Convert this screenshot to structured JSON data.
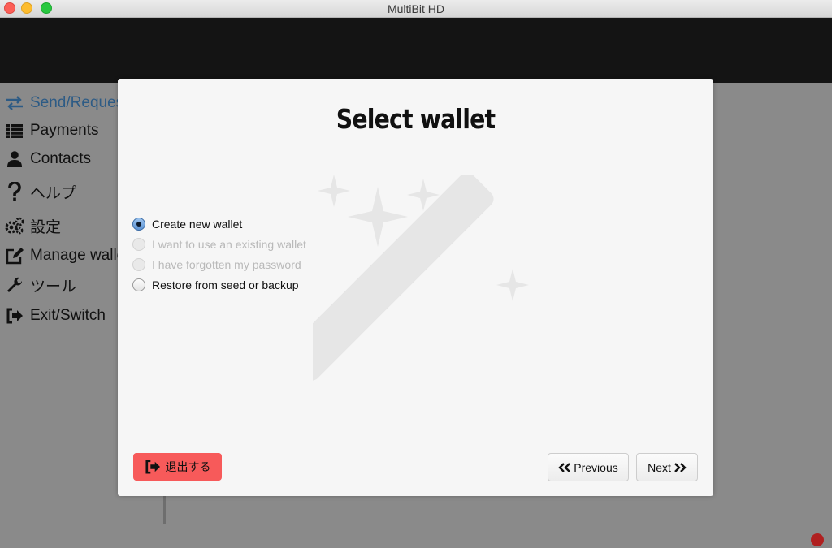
{
  "window": {
    "title": "MultiBit HD"
  },
  "sidebar": {
    "items": [
      {
        "label": "Send/Request",
        "icon": "exchange-icon",
        "active": true
      },
      {
        "label": "Payments",
        "icon": "list-icon"
      },
      {
        "label": "Contacts",
        "icon": "user-icon"
      },
      {
        "label": "ヘルプ",
        "icon": "question-icon"
      },
      {
        "label": "設定",
        "icon": "gears-icon"
      },
      {
        "label": "Manage wallet",
        "icon": "edit-icon"
      },
      {
        "label": "ツール",
        "icon": "wrench-icon"
      },
      {
        "label": "Exit/Switch",
        "icon": "sign-out-icon"
      }
    ]
  },
  "dialog": {
    "title": "Select wallet",
    "options": [
      {
        "label": "Create new wallet",
        "checked": true,
        "enabled": true
      },
      {
        "label": "I want to use an existing wallet",
        "checked": false,
        "enabled": false
      },
      {
        "label": "I have forgotten my password",
        "checked": false,
        "enabled": false
      },
      {
        "label": "Restore from seed or backup",
        "checked": false,
        "enabled": true
      }
    ],
    "exit_label": "退出する",
    "previous_label": "Previous",
    "next_label": "Next"
  },
  "colors": {
    "accent": "#2d5b85",
    "exit_button": "#f75a5a",
    "status_dot": "#b02020"
  }
}
